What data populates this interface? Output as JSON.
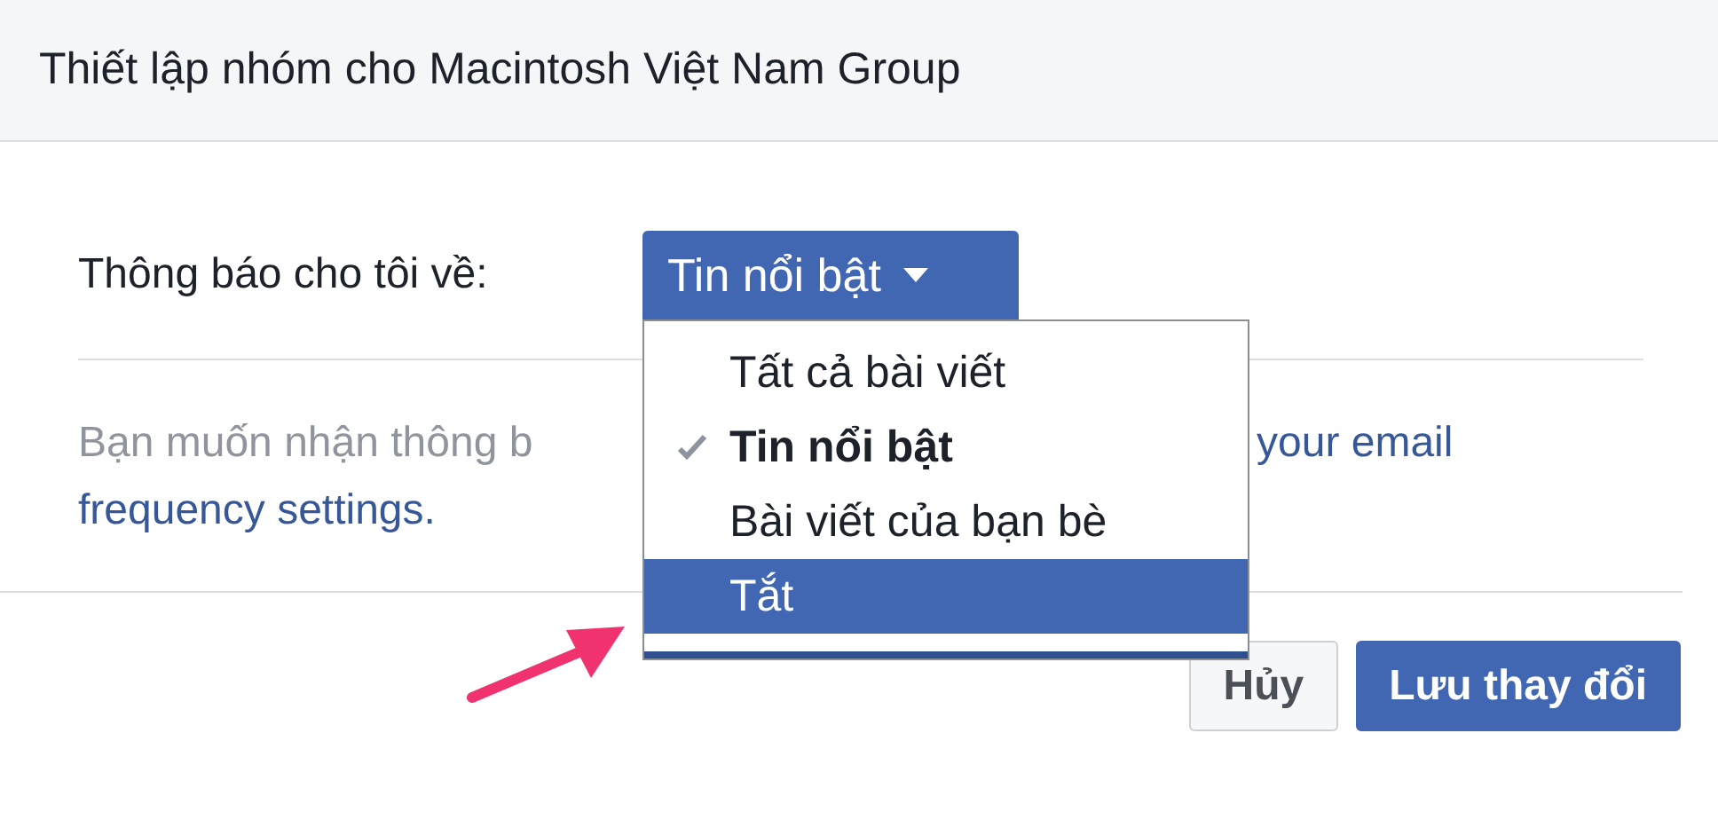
{
  "dialog": {
    "title": "Thiết lập nhóm cho Macintosh Việt Nam Group"
  },
  "notify": {
    "label": "Thông báo cho tôi về:",
    "dropdown": {
      "value": "Tin nổi bật",
      "expanded": true
    }
  },
  "menu": [
    {
      "label": "Tất cả bài viết",
      "checked": false,
      "selected": false
    },
    {
      "label": "Tin nổi bật",
      "checked": true,
      "selected": false
    },
    {
      "label": "Bài viết của bạn bè",
      "checked": false,
      "selected": false
    },
    {
      "label": "Tắt",
      "checked": false,
      "selected": true
    }
  ],
  "description": {
    "text": "Bạn muốn nhận thông b",
    "link_parts": [
      "your email",
      "frequency settings."
    ]
  },
  "buttons": [
    {
      "label": "Hủy",
      "kind": "secondary"
    },
    {
      "label": "Lưu thay đổi",
      "kind": "primary"
    }
  ]
}
